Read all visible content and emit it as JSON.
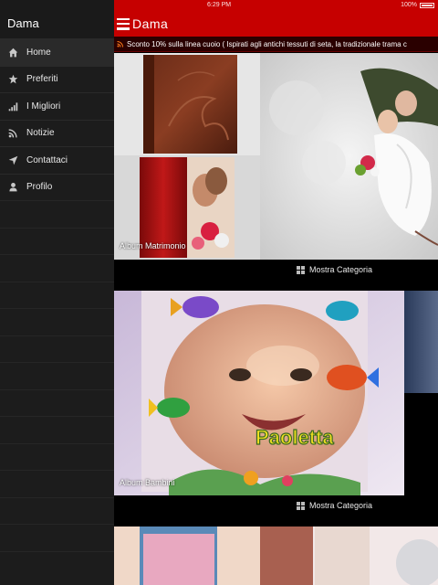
{
  "sidebar": {
    "title": "Dama",
    "items": [
      {
        "label": "Home",
        "icon": "home-icon"
      },
      {
        "label": "Preferiti",
        "icon": "star-icon"
      },
      {
        "label": "I Migliori",
        "icon": "signal-bars-icon"
      },
      {
        "label": "Notizie",
        "icon": "rss-icon"
      },
      {
        "label": "Contattaci",
        "icon": "location-arrow-icon"
      },
      {
        "label": "Profilo",
        "icon": "user-icon"
      }
    ]
  },
  "status": {
    "time": "6:29 PM",
    "battery": "100%"
  },
  "header": {
    "title": "Dama"
  },
  "ticker": {
    "text": "Sconto 10% sulla linea cuoio ( Ispirati agli antichi tessuti di seta, la tradizionale trama c"
  },
  "albums": [
    {
      "label": "Album Matrimonio",
      "action": "Mostra Categoria"
    },
    {
      "label": "Album Bambini",
      "action": "Mostra Categoria"
    }
  ],
  "colors": {
    "brand_red": "#c60000",
    "sidebar_bg": "#1c1c1c"
  }
}
